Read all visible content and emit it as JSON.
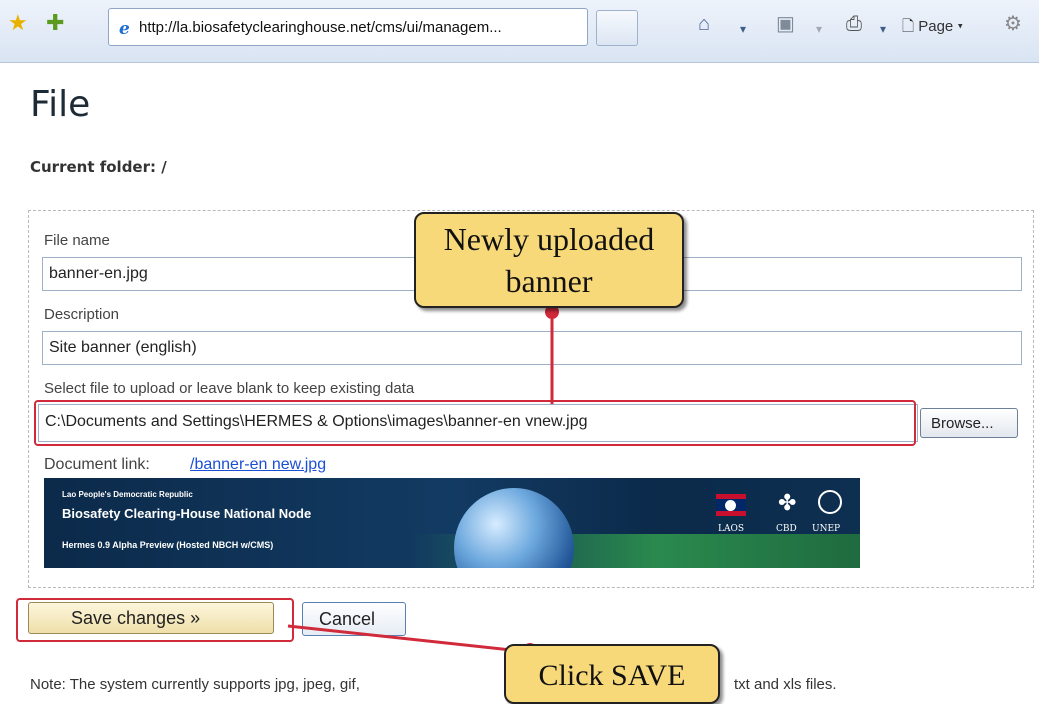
{
  "browser": {
    "url": "http://la.biosafetyclearinghouse.net/cms/ui/managem...",
    "page_menu_label": "Page",
    "icons": [
      "favorites-star-icon",
      "add-favorite-icon",
      "ie-logo-icon",
      "home-icon",
      "feeds-icon",
      "print-icon",
      "page-icon",
      "tools-gear-icon"
    ]
  },
  "page": {
    "title": "File",
    "current_folder": "Current folder: /"
  },
  "form": {
    "filename_label": "File name",
    "filename_value": "banner-en.jpg",
    "description_label": "Description",
    "description_value": "Site banner (english)",
    "upload_label": "Select file to upload or leave blank to keep existing data",
    "upload_value": "C:\\Documents and Settings\\HERMES & Options\\images\\banner-en vnew.jpg",
    "browse_label": "Browse...",
    "doclink_label": "Document link:",
    "doclink_value": "/banner-en new.jpg"
  },
  "banner": {
    "small": "Lao People's Democratic Republic",
    "title": "Biosafety Clearing-House National Node",
    "sub": "Hermes 0.9 Alpha Preview (Hosted NBCH w/CMS)",
    "logos": [
      "LAOS",
      "CBD",
      "UNEP"
    ]
  },
  "actions": {
    "save_label": "Save changes »",
    "cancel_label": "Cancel"
  },
  "note": {
    "before": "Note: The system currently supports jpg, jpeg, gif,",
    "after": "txt and xls files."
  },
  "callouts": {
    "uploaded": "Newly uploaded banner",
    "save": "Click SAVE"
  },
  "colors": {
    "highlight_red": "#d12a3a",
    "callout_fill": "#f8d97a",
    "link_blue": "#1b4fd6"
  }
}
